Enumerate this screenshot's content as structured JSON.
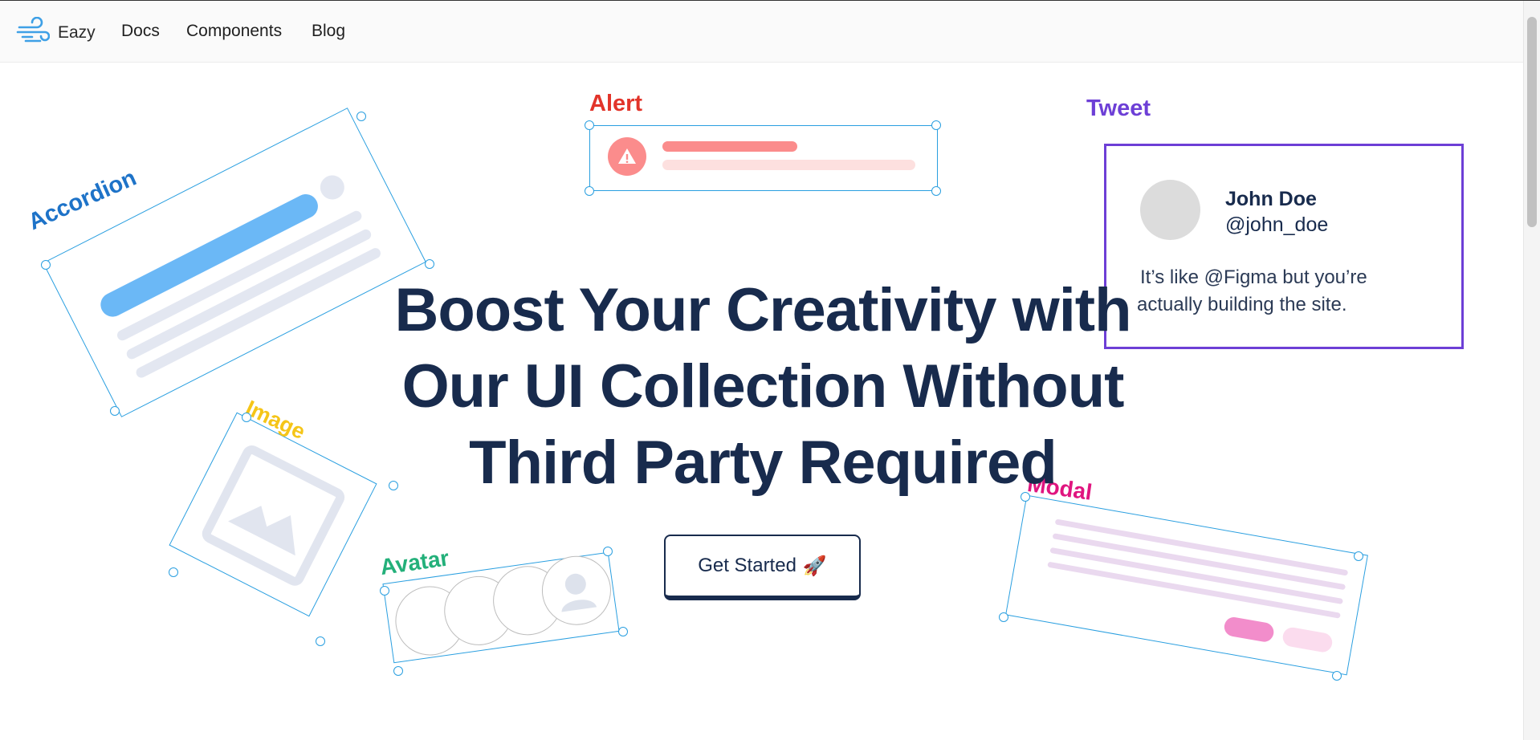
{
  "nav": {
    "brand": "Eazy",
    "links": [
      "Docs",
      "Components",
      "Blog"
    ]
  },
  "hero": {
    "headline_lines": [
      "Boost Your Creativity with",
      "Our UI Collection Without",
      "Third Party Required"
    ],
    "cta_label": "Get Started",
    "cta_icon": "🚀"
  },
  "components": {
    "accordion": "Accordion",
    "alert": "Alert",
    "tweet": "Tweet",
    "image": "Image",
    "avatar": "Avatar",
    "modal": "Modal"
  },
  "tweet": {
    "name": "John Doe",
    "handle": "@john_doe",
    "text_line1": "It’s like @Figma but you’re",
    "text_line2": "actually building the site."
  },
  "colors": {
    "accent": "#2a9fe0",
    "headline": "#182b4d",
    "accordion": "#1e73c8",
    "alert": "#e2342a",
    "tweet": "#6d3fd6",
    "image": "#f5c518",
    "avatar": "#23b07a",
    "modal": "#e0157f"
  }
}
